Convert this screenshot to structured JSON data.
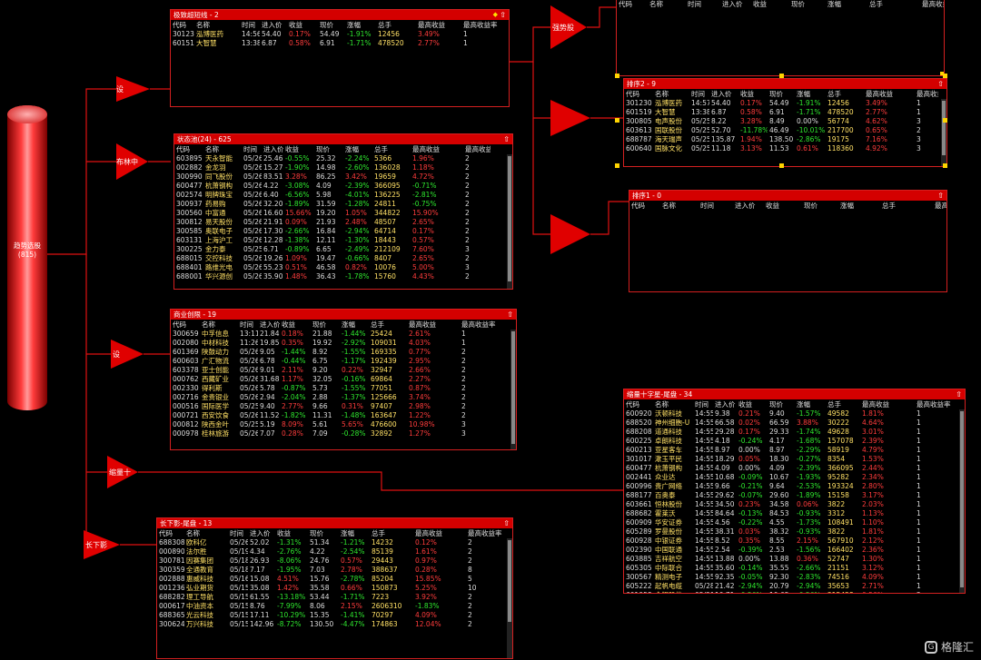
{
  "root": {
    "label": "趋势选股",
    "count": "(815)"
  },
  "nodes": {
    "n1": "设",
    "n2": "布林中",
    "n3": "设",
    "n4": "缩量十",
    "n5": "长下影",
    "n6": "强势股"
  },
  "columns": [
    "代码",
    "名称",
    "时间",
    "进入价",
    "收益",
    "现价",
    "涨幅",
    "总手",
    "最高收益",
    "最高收益率"
  ],
  "panels": {
    "p1": {
      "title": "极致超短线 - 2",
      "rows": [
        [
          "301230",
          "泓博医药",
          "14:56",
          "54.40",
          "0.17%",
          "54.49",
          "-1.91%",
          "12456",
          "3.49%",
          "1"
        ],
        [
          "601519",
          "大智慧",
          "13:38",
          "6.87",
          "0.58%",
          "6.91",
          "-1.71%",
          "478520",
          "2.77%",
          "1"
        ]
      ]
    },
    "p2": {
      "title": "状态池(24) - 625",
      "rows": [
        [
          "603895",
          "天永智能",
          "05/26",
          "25.46",
          "-0.55%",
          "25.32",
          "-2.24%",
          "5366",
          "1.96%",
          "2"
        ],
        [
          "002882",
          "金龙羽",
          "05/26",
          "15.27",
          "-1.90%",
          "14.98",
          "-2.60%",
          "136028",
          "1.18%",
          "2"
        ],
        [
          "300990",
          "同飞股份",
          "05/26",
          "83.51",
          "3.28%",
          "86.25",
          "3.42%",
          "19659",
          "4.72%",
          "2"
        ],
        [
          "600477",
          "杭萧钢构",
          "05/26",
          "4.22",
          "-3.08%",
          "4.09",
          "-2.39%",
          "366095",
          "-0.71%",
          "2"
        ],
        [
          "002574",
          "明牌珠宝",
          "05/26",
          "6.40",
          "-6.56%",
          "5.98",
          "-4.01%",
          "136225",
          "-2.81%",
          "2"
        ],
        [
          "300937",
          "药易购",
          "05/26",
          "32.20",
          "-1.89%",
          "31.59",
          "-1.28%",
          "24811",
          "-0.75%",
          "2"
        ],
        [
          "300560",
          "中富通",
          "05/26",
          "16.60",
          "15.66%",
          "19.20",
          "1.05%",
          "344822",
          "15.90%",
          "2"
        ],
        [
          "300812",
          "易天股份",
          "05/26",
          "21.91",
          "0.09%",
          "21.93",
          "2.48%",
          "48507",
          "2.65%",
          "2"
        ],
        [
          "300585",
          "奥联电子",
          "05/26",
          "17.30",
          "-2.66%",
          "16.84",
          "-2.94%",
          "64714",
          "0.17%",
          "2"
        ],
        [
          "603131",
          "上海沪工",
          "05/26",
          "12.28",
          "-1.38%",
          "12.11",
          "-1.30%",
          "18443",
          "0.57%",
          "2"
        ],
        [
          "300225",
          "金力泰",
          "05/25",
          "6.71",
          "-0.89%",
          "6.65",
          "-2.49%",
          "212109",
          "7.60%",
          "3"
        ],
        [
          "688015",
          "交控科技",
          "05/26",
          "19.26",
          "1.09%",
          "19.47",
          "-0.66%",
          "8407",
          "2.65%",
          "2"
        ],
        [
          "688401",
          "路维光电",
          "05/26",
          "55.23",
          "0.51%",
          "46.58",
          "0.82%",
          "10076",
          "5.00%",
          "3"
        ],
        [
          "688001",
          "华兴源创",
          "05/26",
          "35.90",
          "1.48%",
          "36.43",
          "-1.78%",
          "15760",
          "4.43%",
          "2"
        ]
      ]
    },
    "p3": {
      "title": "商业创限 - 19",
      "rows": [
        [
          "300659",
          "中孚信息",
          "13:11",
          "21.84",
          "0.18%",
          "21.88",
          "-1.44%",
          "25424",
          "2.61%",
          "1"
        ],
        [
          "002080",
          "中材科技",
          "11:26",
          "19.85",
          "0.35%",
          "19.92",
          "-2.92%",
          "109031",
          "4.03%",
          "1"
        ],
        [
          "601369",
          "陕鼓动力",
          "05/26",
          "9.05",
          "-1.44%",
          "8.92",
          "-1.55%",
          "169335",
          "0.77%",
          "2"
        ],
        [
          "600603",
          "广汇物流",
          "05/26",
          "6.78",
          "-0.44%",
          "6.75",
          "-1.17%",
          "192439",
          "2.95%",
          "2"
        ],
        [
          "603378",
          "亚士创能",
          "05/26",
          "9.01",
          "2.11%",
          "9.20",
          "0.22%",
          "32947",
          "2.66%",
          "2"
        ],
        [
          "000762",
          "西藏矿业",
          "05/26",
          "31.68",
          "1.17%",
          "32.05",
          "-0.16%",
          "69864",
          "2.27%",
          "2"
        ],
        [
          "002330",
          "得利斯",
          "05/26",
          "5.78",
          "-0.87%",
          "5.73",
          "-1.55%",
          "77051",
          "0.87%",
          "2"
        ],
        [
          "002716",
          "金贵银业",
          "05/26",
          "2.94",
          "-2.04%",
          "2.88",
          "-1.37%",
          "125666",
          "3.74%",
          "2"
        ],
        [
          "000516",
          "国际医学",
          "05/25",
          "9.40",
          "2.77%",
          "9.66",
          "0.31%",
          "97407",
          "2.98%",
          "2"
        ],
        [
          "000721",
          "西安饮食",
          "05/26",
          "11.52",
          "-1.82%",
          "11.31",
          "-1.48%",
          "163647",
          "1.22%",
          "2"
        ],
        [
          "000812",
          "陕西金叶",
          "05/25",
          "5.19",
          "8.09%",
          "5.61",
          "5.65%",
          "476600",
          "10.98%",
          "3"
        ],
        [
          "000978",
          "桂林旅游",
          "05/26",
          "7.07",
          "0.28%",
          "7.09",
          "-0.28%",
          "32892",
          "1.27%",
          "3"
        ]
      ]
    },
    "p4": {
      "title": "长下影-尾盘 - 13",
      "rows": [
        [
          "688308",
          "欧科亿",
          "05/26",
          "52.02",
          "-1.31%",
          "51.34",
          "-1.21%",
          "14232",
          "0.12%",
          "2"
        ],
        [
          "000890",
          "法尔胜",
          "05/19",
          "4.34",
          "-2.76%",
          "4.22",
          "-2.54%",
          "85139",
          "1.61%",
          "2"
        ],
        [
          "300781",
          "因赛集团",
          "05/18",
          "26.93",
          "-8.06%",
          "24.76",
          "0.57%",
          "29443",
          "0.97%",
          "2"
        ],
        [
          "300359",
          "全通教育",
          "05/18",
          "7.17",
          "-1.95%",
          "7.03",
          "2.78%",
          "388637",
          "0.28%",
          "8"
        ],
        [
          "002888",
          "惠威科技",
          "05/16",
          "15.08",
          "4.51%",
          "15.76",
          "-2.78%",
          "85204",
          "15.85%",
          "5"
        ],
        [
          "001236",
          "弘业期货",
          "05/15",
          "35.08",
          "1.42%",
          "35.58",
          "0.66%",
          "150873",
          "5.25%",
          "10"
        ],
        [
          "688282",
          "理工导航",
          "05/15",
          "61.55",
          "-13.18%",
          "53.44",
          "-1.71%",
          "7223",
          "3.92%",
          "2"
        ],
        [
          "000617",
          "中油资本",
          "05/15",
          "8.76",
          "-7.99%",
          "8.06",
          "2.15%",
          "2606310",
          "-1.83%",
          "2"
        ],
        [
          "688365",
          "光云科技",
          "05/15",
          "17.11",
          "-10.29%",
          "15.35",
          "-1.41%",
          "70297",
          "4.09%",
          "2"
        ],
        [
          "300624",
          "万兴科技",
          "05/15",
          "142.96",
          "-8.72%",
          "130.50",
          "-4.47%",
          "174863",
          "12.04%",
          "2"
        ]
      ]
    },
    "p5": {
      "title": "",
      "rows": []
    },
    "p6": {
      "title": "排序2 - 9",
      "rows": [
        [
          "301230",
          "泓博医药",
          "14:57",
          "54.40",
          "0.17%",
          "54.49",
          "-1.91%",
          "12456",
          "3.49%",
          "1"
        ],
        [
          "601519",
          "大智慧",
          "13:38",
          "6.87",
          "0.58%",
          "6.91",
          "-1.71%",
          "478520",
          "2.77%",
          "1"
        ],
        [
          "300805",
          "电声股份",
          "05/25",
          "8.22",
          "3.28%",
          "8.49",
          "0.00%",
          "56774",
          "4.62%",
          "3"
        ],
        [
          "603613",
          "国联股份",
          "05/25",
          "52.70",
          "-11.78%",
          "46.49",
          "-10.01%",
          "217700",
          "0.65%",
          "2"
        ],
        [
          "688787",
          "海天瑞声",
          "05/25",
          "135.87",
          "1.94%",
          "138.50",
          "-2.86%",
          "19175",
          "7.16%",
          "3"
        ],
        [
          "600640",
          "国脉文化",
          "05/25",
          "11.18",
          "3.13%",
          "11.53",
          "0.61%",
          "118360",
          "4.92%",
          "3"
        ]
      ]
    },
    "p7": {
      "title": "排序1 - 0",
      "rows": []
    },
    "p8": {
      "title": "缩量十字星-尾盘 - 34",
      "rows": [
        [
          "600920",
          "沃顿科技",
          "14:55",
          "9.38",
          "0.21%",
          "9.40",
          "-1.57%",
          "49582",
          "1.81%",
          "1"
        ],
        [
          "688520",
          "神州细胞-U",
          "14:55",
          "66.58",
          "0.02%",
          "66.59",
          "3.88%",
          "30222",
          "4.64%",
          "1"
        ],
        [
          "688208",
          "道通科技",
          "14:55",
          "29.28",
          "0.17%",
          "29.33",
          "-1.74%",
          "49628",
          "3.01%",
          "1"
        ],
        [
          "600225",
          "卓朗科技",
          "14:55",
          "4.18",
          "-0.24%",
          "4.17",
          "-1.68%",
          "157078",
          "2.39%",
          "1"
        ],
        [
          "600213",
          "亚星客车",
          "14:55",
          "8.97",
          "0.00%",
          "8.97",
          "-2.29%",
          "58919",
          "4.79%",
          "1"
        ],
        [
          "301017",
          "漱玉平民",
          "14:55",
          "18.29",
          "0.05%",
          "18.30",
          "-0.27%",
          "8354",
          "1.53%",
          "1"
        ],
        [
          "600477",
          "杭萧钢构",
          "14:55",
          "4.09",
          "0.00%",
          "4.09",
          "-2.39%",
          "366095",
          "2.44%",
          "1"
        ],
        [
          "002441",
          "众业达",
          "14:55",
          "10.68",
          "-0.09%",
          "10.67",
          "-1.93%",
          "95282",
          "2.34%",
          "1"
        ],
        [
          "600996",
          "贵广网络",
          "14:55",
          "9.66",
          "-0.21%",
          "9.64",
          "-2.53%",
          "193324",
          "2.80%",
          "1"
        ],
        [
          "688177",
          "百奥泰",
          "14:55",
          "29.62",
          "-0.07%",
          "29.60",
          "-1.89%",
          "15158",
          "3.17%",
          "1"
        ],
        [
          "603661",
          "恒林股份",
          "14:55",
          "34.50",
          "0.23%",
          "34.58",
          "0.06%",
          "3822",
          "2.03%",
          "1"
        ],
        [
          "688682",
          "霍莱沃",
          "14:55",
          "84.64",
          "-0.13%",
          "84.53",
          "-0.93%",
          "3312",
          "1.13%",
          "1"
        ],
        [
          "600909",
          "华安证券",
          "14:55",
          "4.56",
          "-0.22%",
          "4.55",
          "-1.73%",
          "108491",
          "1.10%",
          "1"
        ],
        [
          "605289",
          "罗曼股份",
          "14:55",
          "38.31",
          "0.03%",
          "38.32",
          "-0.93%",
          "3822",
          "1.81%",
          "1"
        ],
        [
          "600928",
          "中银证券",
          "14:55",
          "8.52",
          "0.35%",
          "8.55",
          "2.15%",
          "567910",
          "2.12%",
          "1"
        ],
        [
          "002390",
          "中国联通",
          "14:55",
          "2.54",
          "-0.39%",
          "2.53",
          "-1.56%",
          "166402",
          "2.36%",
          "1"
        ],
        [
          "603885",
          "吉祥航空",
          "14:55",
          "13.88",
          "0.00%",
          "13.88",
          "0.36%",
          "52747",
          "1.30%",
          "1"
        ],
        [
          "605305",
          "中际联合",
          "14:55",
          "35.60",
          "-0.14%",
          "35.55",
          "-2.66%",
          "21151",
          "3.12%",
          "1"
        ],
        [
          "300567",
          "精测电子",
          "14:55",
          "92.35",
          "-0.05%",
          "92.30",
          "-2.83%",
          "74516",
          "4.09%",
          "1"
        ],
        [
          "605222",
          "起帆电缆",
          "05/28",
          "21.42",
          "-2.94%",
          "20.79",
          "-2.94%",
          "35653",
          "2.71%",
          "1"
        ],
        [
          "601958",
          "金钼股份",
          "05/28",
          "10.71",
          "-0.56%",
          "10.65",
          "-0.56%",
          "215428",
          "0.56%",
          "2"
        ]
      ]
    }
  },
  "watermark": "格隆汇"
}
